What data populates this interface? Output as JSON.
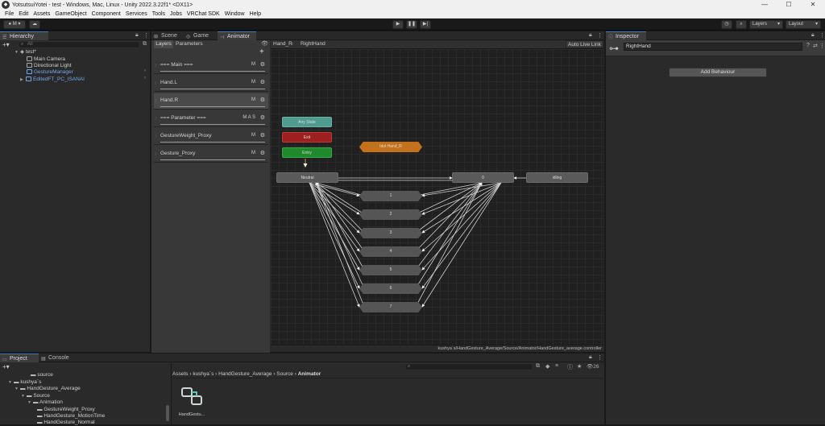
{
  "window": {
    "title": "YotsutsuiYotei - test - Windows, Mac, Linux - Unity 2022.3.22f1* <DX11>",
    "minimize": "—",
    "maximize": "☐",
    "close": "✕"
  },
  "menu": [
    "File",
    "Edit",
    "Assets",
    "GameObject",
    "Component",
    "Services",
    "Tools",
    "Jobs",
    "VRChat SDK",
    "Window",
    "Help"
  ],
  "toolbar": {
    "account_label": "M ▾",
    "play": "▶",
    "pause": "❚❚",
    "step": "▶|",
    "layers_label": "Layers",
    "layout_label": "Layout"
  },
  "hierarchy": {
    "tab": "Hierarchy",
    "search_placeholder": "All",
    "rows": [
      {
        "label": "test*",
        "indent": 0
      },
      {
        "label": "Main Camera",
        "indent": 1
      },
      {
        "label": "Directional Light",
        "indent": 1
      },
      {
        "label": "GestureManager",
        "indent": 1
      },
      {
        "label": "EditedFT_PC_ISANAI",
        "indent": 1
      }
    ]
  },
  "animator": {
    "tabs": [
      "Scene",
      "Game",
      "Animator"
    ],
    "subtabs": [
      "Layers",
      "Parameters"
    ],
    "breadcrumb": [
      "Hand_R",
      "RightHand"
    ],
    "auto_live_link": "Auto Live Link",
    "layers": [
      {
        "name": "=== Main ===",
        "flags": "M"
      },
      {
        "name": "Hand.L",
        "flags": "M"
      },
      {
        "name": "Hand.R",
        "flags": "M"
      },
      {
        "name": "=== Parameter ===",
        "flags": "M A S"
      },
      {
        "name": "GestureWeight_Proxy",
        "flags": "M"
      },
      {
        "name": "Gesture_Proxy",
        "flags": "M"
      }
    ],
    "states": {
      "any_state": "Any State",
      "exit": "Exit",
      "entry": "Entry",
      "sub_state": "Idol Hand_R",
      "neutral": "Neutral",
      "zero": "0",
      "idling": "idling",
      "numbered": [
        "1",
        "2",
        "3",
        "4",
        "5",
        "6",
        "7"
      ]
    },
    "colors": {
      "any_state": "#4f9c8f",
      "exit": "#9d1f1f",
      "entry": "#1f8a2c",
      "sub_state": "#c4711b"
    },
    "path": "kushya`s/HandGesture_Average/Source/Animator/HandGesture_average.controller"
  },
  "inspector": {
    "tab": "Inspector",
    "object_name": "RightHand",
    "add_behaviour": "Add Behaviour"
  },
  "project": {
    "tabs": [
      "Project",
      "Console"
    ],
    "tree": [
      {
        "label": "source",
        "indent": 2
      },
      {
        "label": "kushya`s",
        "indent": 0
      },
      {
        "label": "HandGesture_Average",
        "indent": 1
      },
      {
        "label": "Source",
        "indent": 2
      },
      {
        "label": "Animation",
        "indent": 3
      },
      {
        "label": "GestureWeight_Proxy",
        "indent": 4
      },
      {
        "label": "HandGesture_MotionTime",
        "indent": 4
      },
      {
        "label": "HandGesture_Normal",
        "indent": 4
      }
    ],
    "breadcrumb": [
      "Assets",
      "kushya`s",
      "HandGesture_Average",
      "Source",
      "Animator"
    ],
    "count": "26",
    "asset_label": "HandGestu..."
  }
}
